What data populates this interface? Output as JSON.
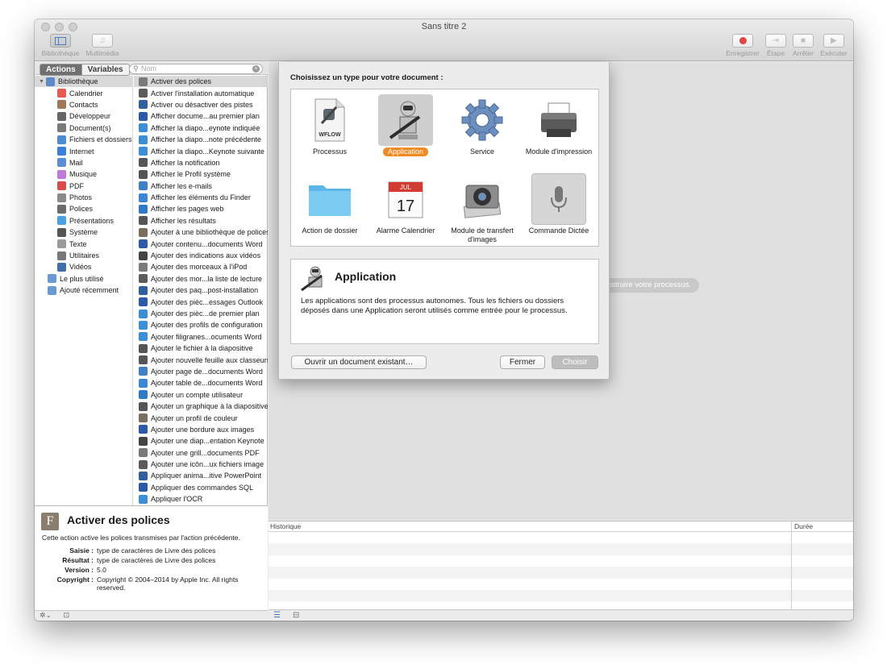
{
  "window": {
    "title": "Sans titre 2"
  },
  "toolbar": {
    "library_label": "Bibliothèque",
    "media_label": "Multimédia",
    "record_label": "Enregistrer",
    "step_label": "Étape",
    "stop_label": "Arrêter",
    "run_label": "Exécuter"
  },
  "left_panel": {
    "actions_tab": "Actions",
    "variables_tab": "Variables",
    "search_placeholder": "Nom",
    "library_root": "Bibliothèque",
    "library_items": [
      "Calendrier",
      "Contacts",
      "Développeur",
      "Document(s)",
      "Fichiers et dossiers",
      "Internet",
      "Mail",
      "Musique",
      "PDF",
      "Photos",
      "Polices",
      "Présentations",
      "Système",
      "Texte",
      "Utilitaires",
      "Vidéos"
    ],
    "library_extra": [
      "Le plus utilisé",
      "Ajouté récemment"
    ],
    "actions": [
      "Activer des polices",
      "Activer l'installation automatique",
      "Activer ou désactiver des pistes",
      "Afficher docume...au premier plan",
      "Afficher la diapo...eynote indiquée",
      "Afficher la diapo...note précédente",
      "Afficher la diapo...Keynote suivante",
      "Afficher la notification",
      "Afficher le Profil système",
      "Afficher les e-mails",
      "Afficher les éléments du Finder",
      "Afficher les pages web",
      "Afficher les résultats",
      "Ajouter à une bibliothèque de polices",
      "Ajouter contenu...documents Word",
      "Ajouter des indications aux vidéos",
      "Ajouter des morceaux à l'iPod",
      "Ajouter des mor...la liste de lecture",
      "Ajouter des paq...post-installation",
      "Ajouter des pièc...essages Outlook",
      "Ajouter des pièc...de premier plan",
      "Ajouter des profils de configuration",
      "Ajouter filigranes...ocuments Word",
      "Ajouter le fichier à la diapositive",
      "Ajouter nouvelle feuille aux classeurs",
      "Ajouter page de...documents Word",
      "Ajouter table de...documents Word",
      "Ajouter un compte utilisateur",
      "Ajouter un graphique à la diapositive",
      "Ajouter un profil de couleur",
      "Ajouter une bordure aux images",
      "Ajouter une diap...entation Keynote",
      "Ajouter une grill...documents PDF",
      "Ajouter une icôn...ux fichiers image",
      "Appliquer anima...itive PowerPoint",
      "Appliquer des commandes SQL",
      "Appliquer l'OCR"
    ]
  },
  "info": {
    "title": "Activer des polices",
    "description": "Cette action active les polices transmises par l'action précédente.",
    "fields": [
      {
        "k": "Saisie :",
        "v": "type de caractères de Livre des polices"
      },
      {
        "k": "Résultat :",
        "v": "type de caractères de Livre des polices"
      },
      {
        "k": "Version :",
        "v": "5.0"
      },
      {
        "k": "Copyright :",
        "v": "Copyright © 2004–2014 by Apple Inc. All rights reserved."
      }
    ]
  },
  "workflow": {
    "hint": "nstruire votre processus."
  },
  "history": {
    "col_history": "Historique",
    "col_duration": "Durée"
  },
  "sheet": {
    "prompt": "Choisissez un type pour votre document :",
    "types": [
      {
        "label": "Processus",
        "icon": "workflow-icon"
      },
      {
        "label": "Application",
        "icon": "application-robot-icon"
      },
      {
        "label": "Service",
        "icon": "gear-icon"
      },
      {
        "label": "Module d'impression",
        "icon": "printer-icon"
      },
      {
        "label": "Action de dossier",
        "icon": "folder-icon"
      },
      {
        "label": "Alarme Calendrier",
        "icon": "calendar-icon"
      },
      {
        "label": "Module de transfert d'images",
        "icon": "camera-icon"
      },
      {
        "label": "Commande Dictée",
        "icon": "microphone-icon"
      }
    ],
    "selected": "Application",
    "cal_month": "JUL",
    "cal_day": "17",
    "wflow_text": "WFLOW",
    "desc_title": "Application",
    "desc_text": "Les applications sont des processus autonomes. Tous les fichiers ou dossiers déposés dans une Application seront utilisés comme entrée pour le processus.",
    "open_button": "Ouvrir un document existant…",
    "close_button": "Fermer",
    "choose_button": "Choisir"
  },
  "colors": {
    "selection_orange": "#f08a24",
    "record_red": "#e24545"
  }
}
